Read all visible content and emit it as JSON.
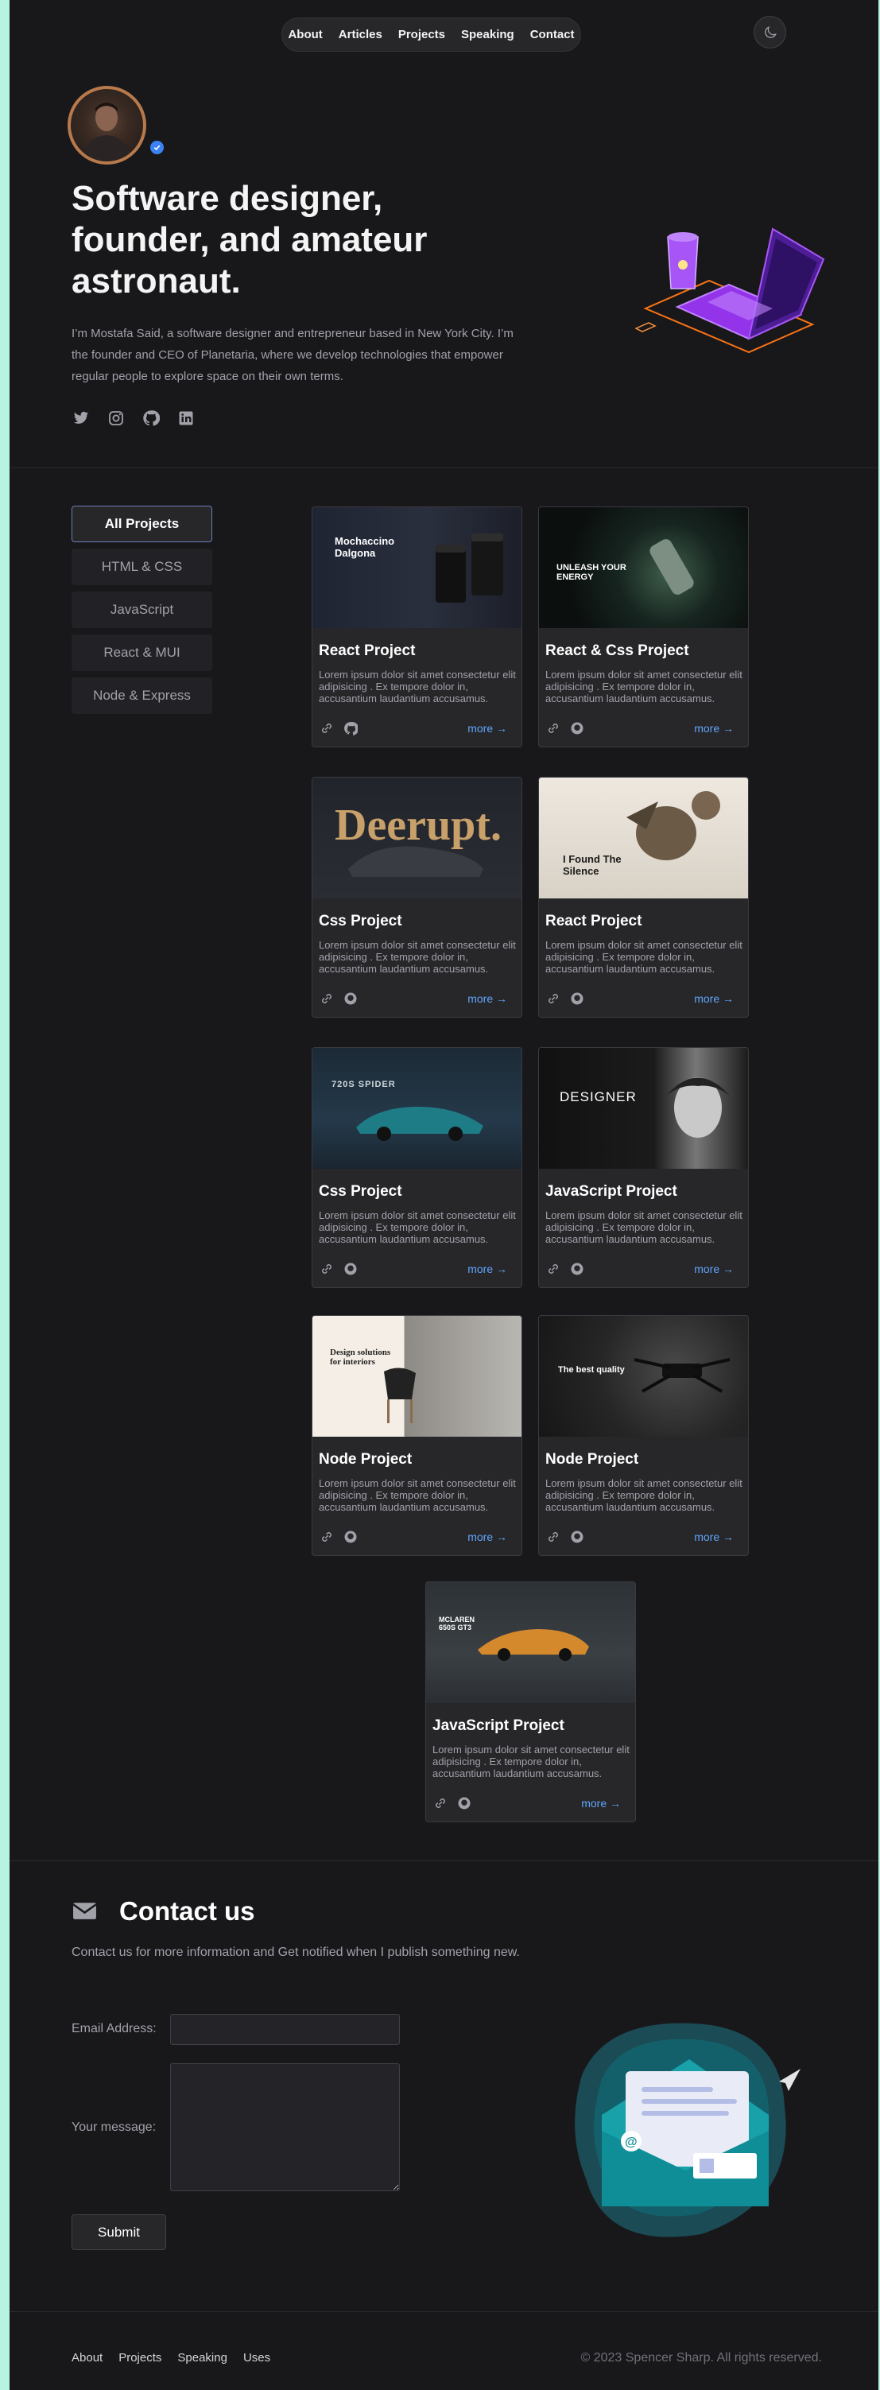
{
  "nav": {
    "items": [
      "About",
      "Articles",
      "Projects",
      "Speaking",
      "Contact"
    ]
  },
  "hero": {
    "title": "Software designer, founder, and amateur astronaut.",
    "text": "I’m Mostafa Said, a software designer and entrepreneur based in New York City. I’m the founder and CEO of Planetaria, where we develop technologies that empower regular people to explore space on their own terms.",
    "socials": [
      "twitter-icon",
      "instagram-icon",
      "github-icon",
      "linkedin-icon"
    ]
  },
  "filters": [
    "All Projects",
    "HTML & CSS",
    "JavaScript",
    "React & MUI",
    "Node & Express"
  ],
  "projects": [
    {
      "title": "React Project",
      "desc": "Lorem ipsum dolor sit amet consectetur elit adipisicing . Ex tempore dolor in, accusantium laudantium accusamus.",
      "more": "more",
      "thumb_text": "Mochaccino Dalgona"
    },
    {
      "title": "React & Css Project",
      "desc": "Lorem ipsum dolor sit amet consectetur elit adipisicing . Ex tempore dolor in, accusantium laudantium accusamus.",
      "more": "more",
      "thumb_text": "UNLEASH YOUR ENERGY"
    },
    {
      "title": "Css Project",
      "desc": "Lorem ipsum dolor sit amet consectetur elit adipisicing . Ex tempore dolor in, accusantium laudantium accusamus.",
      "more": "more",
      "thumb_text": "Deerupt."
    },
    {
      "title": "React Project",
      "desc": "Lorem ipsum dolor sit amet consectetur elit adipisicing . Ex tempore dolor in, accusantium laudantium accusamus.",
      "more": "more",
      "thumb_text": "I Found The Silence"
    },
    {
      "title": "Css Project",
      "desc": "Lorem ipsum dolor sit amet consectetur elit adipisicing . Ex tempore dolor in, accusantium laudantium accusamus.",
      "more": "more",
      "thumb_text": "720S SPIDER"
    },
    {
      "title": "JavaScript Project",
      "desc": "Lorem ipsum dolor sit amet consectetur elit adipisicing . Ex tempore dolor in, accusantium laudantium accusamus.",
      "more": "more",
      "thumb_text": "DESIGNER"
    },
    {
      "title": "Node Project",
      "desc": "Lorem ipsum dolor sit amet consectetur elit adipisicing . Ex tempore dolor in, accusantium laudantium accusamus.",
      "more": "more",
      "thumb_text": "Design solutions for interiors"
    },
    {
      "title": "Node Project",
      "desc": "Lorem ipsum dolor sit amet consectetur elit adipisicing . Ex tempore dolor in, accusantium laudantium accusamus.",
      "more": "more",
      "thumb_text": "The best quality"
    },
    {
      "title": "JavaScript Project",
      "desc": "Lorem ipsum dolor sit amet consectetur elit adipisicing . Ex tempore dolor in, accusantium laudantium accusamus.",
      "more": "more",
      "thumb_text": "MCLAREN 650S GT3"
    }
  ],
  "contact": {
    "title": "Contact us",
    "subtitle": "Contact us for more information and Get notified when I publish something new.",
    "email_label": "Email Address:",
    "email_value": "",
    "message_label": "Your message:",
    "message_value": "",
    "submit": "Submit"
  },
  "footer": {
    "links": [
      "About",
      "Projects",
      "Speaking",
      "Uses"
    ],
    "copyright": "© 2023 Spencer Sharp. All rights reserved."
  },
  "colors": {
    "background": "#18181b",
    "card": "#27272a",
    "accent_link": "#60a5fa",
    "side_strip": "#b6f3e0"
  }
}
